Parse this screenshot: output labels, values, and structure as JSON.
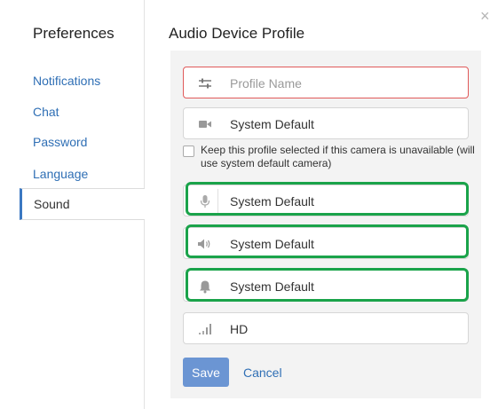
{
  "sidebar": {
    "title": "Preferences",
    "items": [
      {
        "label": "Notifications"
      },
      {
        "label": "Chat"
      },
      {
        "label": "Password"
      },
      {
        "label": "Language"
      },
      {
        "label": "Sound"
      }
    ]
  },
  "main": {
    "title": "Audio Device Profile",
    "close_icon": "×",
    "profile_name_placeholder": "Profile Name",
    "camera_value": "System Default",
    "checkbox_label": "Keep this profile selected if this camera is unavailable (will use system default camera)",
    "microphone_value": "System Default",
    "speaker_value": "System Default",
    "ringer_value": "System Default",
    "quality_value": "HD",
    "save_label": "Save",
    "cancel_label": "Cancel"
  },
  "colors": {
    "accent": "#2f6fb5",
    "highlight": "#1aa34a",
    "error_border": "#e05a5a"
  }
}
